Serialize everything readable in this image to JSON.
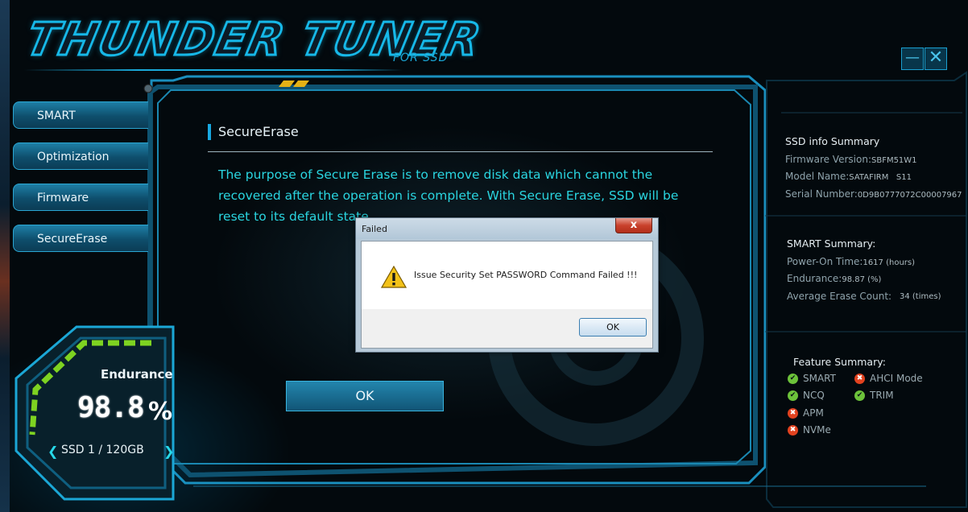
{
  "app": {
    "logo_title": "THUNDER TUNER",
    "logo_subtitle": "FOR SSD",
    "minimize_glyph": "—",
    "close_glyph": "✕"
  },
  "nav": {
    "items": [
      {
        "label": "SMART"
      },
      {
        "label": "Optimization"
      },
      {
        "label": "Firmware"
      },
      {
        "label": "SecureErase"
      }
    ]
  },
  "main": {
    "section_title": "SecureErase",
    "description": "The purpose of Secure Erase is to remove disk data which cannot the recovered after the operation is complete. With Secure Erase, SSD will be reset to its default state.",
    "ok_label": "OK"
  },
  "gauge": {
    "label": "Endurance",
    "value": "98.8",
    "unit": "%",
    "level_percent": 98.8,
    "ssd_label": "SSD 1 / 120GB",
    "prev_glyph": "❮",
    "next_glyph": "❯"
  },
  "ssd_info": {
    "title": "SSD info Summary",
    "firmware_label": "Firmware Version:",
    "firmware_value": "SBFM51W1",
    "model_label": "Model Name:",
    "model_value": "SATAFIRM   S11",
    "serial_label": "Serial Number:",
    "serial_value": "0D9B0777072C00007967"
  },
  "smart_summary": {
    "title": "SMART Summary:",
    "power_on_label": "Power-On Time:",
    "power_on_value": "1617 (hours)",
    "endurance_label": "Endurance:",
    "endurance_value": "98.87 (%)",
    "erase_label": "Average Erase Count:",
    "erase_value": "34 (times)"
  },
  "features": {
    "title": "Feature Summary:",
    "items": [
      {
        "label": "SMART",
        "status": "ok"
      },
      {
        "label": "AHCI Mode",
        "status": "bad"
      },
      {
        "label": "NCQ",
        "status": "ok"
      },
      {
        "label": "TRIM",
        "status": "ok"
      },
      {
        "label": "APM",
        "status": "bad"
      },
      {
        "label": "NVMe",
        "status": "bad"
      }
    ],
    "ok_glyph": "✔",
    "bad_glyph": "✖"
  },
  "dialog": {
    "title": "Failed",
    "close_glyph": "x",
    "message": "Issue Security Set PASSWORD Command Failed !!!",
    "ok_label": "OK",
    "icon": "warning-icon"
  },
  "colors": {
    "accent": "#18a8e0",
    "description_text": "#2ad5e0",
    "gauge_green": "#7ed321",
    "ok_green": "#6cc23a",
    "bad_red": "#e2421f"
  }
}
